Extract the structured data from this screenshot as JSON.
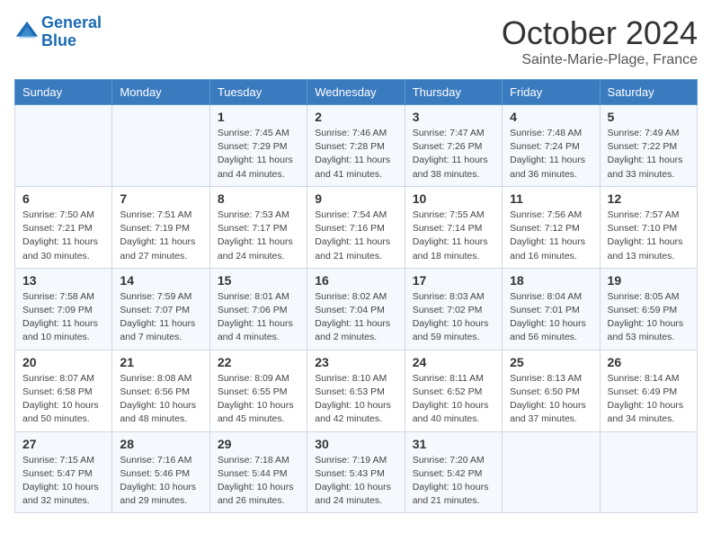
{
  "header": {
    "logo_line1": "General",
    "logo_line2": "Blue",
    "month": "October 2024",
    "location": "Sainte-Marie-Plage, France"
  },
  "days_of_week": [
    "Sunday",
    "Monday",
    "Tuesday",
    "Wednesday",
    "Thursday",
    "Friday",
    "Saturday"
  ],
  "weeks": [
    [
      {
        "day": "",
        "info": ""
      },
      {
        "day": "",
        "info": ""
      },
      {
        "day": "1",
        "info": "Sunrise: 7:45 AM\nSunset: 7:29 PM\nDaylight: 11 hours and 44 minutes."
      },
      {
        "day": "2",
        "info": "Sunrise: 7:46 AM\nSunset: 7:28 PM\nDaylight: 11 hours and 41 minutes."
      },
      {
        "day": "3",
        "info": "Sunrise: 7:47 AM\nSunset: 7:26 PM\nDaylight: 11 hours and 38 minutes."
      },
      {
        "day": "4",
        "info": "Sunrise: 7:48 AM\nSunset: 7:24 PM\nDaylight: 11 hours and 36 minutes."
      },
      {
        "day": "5",
        "info": "Sunrise: 7:49 AM\nSunset: 7:22 PM\nDaylight: 11 hours and 33 minutes."
      }
    ],
    [
      {
        "day": "6",
        "info": "Sunrise: 7:50 AM\nSunset: 7:21 PM\nDaylight: 11 hours and 30 minutes."
      },
      {
        "day": "7",
        "info": "Sunrise: 7:51 AM\nSunset: 7:19 PM\nDaylight: 11 hours and 27 minutes."
      },
      {
        "day": "8",
        "info": "Sunrise: 7:53 AM\nSunset: 7:17 PM\nDaylight: 11 hours and 24 minutes."
      },
      {
        "day": "9",
        "info": "Sunrise: 7:54 AM\nSunset: 7:16 PM\nDaylight: 11 hours and 21 minutes."
      },
      {
        "day": "10",
        "info": "Sunrise: 7:55 AM\nSunset: 7:14 PM\nDaylight: 11 hours and 18 minutes."
      },
      {
        "day": "11",
        "info": "Sunrise: 7:56 AM\nSunset: 7:12 PM\nDaylight: 11 hours and 16 minutes."
      },
      {
        "day": "12",
        "info": "Sunrise: 7:57 AM\nSunset: 7:10 PM\nDaylight: 11 hours and 13 minutes."
      }
    ],
    [
      {
        "day": "13",
        "info": "Sunrise: 7:58 AM\nSunset: 7:09 PM\nDaylight: 11 hours and 10 minutes."
      },
      {
        "day": "14",
        "info": "Sunrise: 7:59 AM\nSunset: 7:07 PM\nDaylight: 11 hours and 7 minutes."
      },
      {
        "day": "15",
        "info": "Sunrise: 8:01 AM\nSunset: 7:06 PM\nDaylight: 11 hours and 4 minutes."
      },
      {
        "day": "16",
        "info": "Sunrise: 8:02 AM\nSunset: 7:04 PM\nDaylight: 11 hours and 2 minutes."
      },
      {
        "day": "17",
        "info": "Sunrise: 8:03 AM\nSunset: 7:02 PM\nDaylight: 10 hours and 59 minutes."
      },
      {
        "day": "18",
        "info": "Sunrise: 8:04 AM\nSunset: 7:01 PM\nDaylight: 10 hours and 56 minutes."
      },
      {
        "day": "19",
        "info": "Sunrise: 8:05 AM\nSunset: 6:59 PM\nDaylight: 10 hours and 53 minutes."
      }
    ],
    [
      {
        "day": "20",
        "info": "Sunrise: 8:07 AM\nSunset: 6:58 PM\nDaylight: 10 hours and 50 minutes."
      },
      {
        "day": "21",
        "info": "Sunrise: 8:08 AM\nSunset: 6:56 PM\nDaylight: 10 hours and 48 minutes."
      },
      {
        "day": "22",
        "info": "Sunrise: 8:09 AM\nSunset: 6:55 PM\nDaylight: 10 hours and 45 minutes."
      },
      {
        "day": "23",
        "info": "Sunrise: 8:10 AM\nSunset: 6:53 PM\nDaylight: 10 hours and 42 minutes."
      },
      {
        "day": "24",
        "info": "Sunrise: 8:11 AM\nSunset: 6:52 PM\nDaylight: 10 hours and 40 minutes."
      },
      {
        "day": "25",
        "info": "Sunrise: 8:13 AM\nSunset: 6:50 PM\nDaylight: 10 hours and 37 minutes."
      },
      {
        "day": "26",
        "info": "Sunrise: 8:14 AM\nSunset: 6:49 PM\nDaylight: 10 hours and 34 minutes."
      }
    ],
    [
      {
        "day": "27",
        "info": "Sunrise: 7:15 AM\nSunset: 5:47 PM\nDaylight: 10 hours and 32 minutes."
      },
      {
        "day": "28",
        "info": "Sunrise: 7:16 AM\nSunset: 5:46 PM\nDaylight: 10 hours and 29 minutes."
      },
      {
        "day": "29",
        "info": "Sunrise: 7:18 AM\nSunset: 5:44 PM\nDaylight: 10 hours and 26 minutes."
      },
      {
        "day": "30",
        "info": "Sunrise: 7:19 AM\nSunset: 5:43 PM\nDaylight: 10 hours and 24 minutes."
      },
      {
        "day": "31",
        "info": "Sunrise: 7:20 AM\nSunset: 5:42 PM\nDaylight: 10 hours and 21 minutes."
      },
      {
        "day": "",
        "info": ""
      },
      {
        "day": "",
        "info": ""
      }
    ]
  ]
}
